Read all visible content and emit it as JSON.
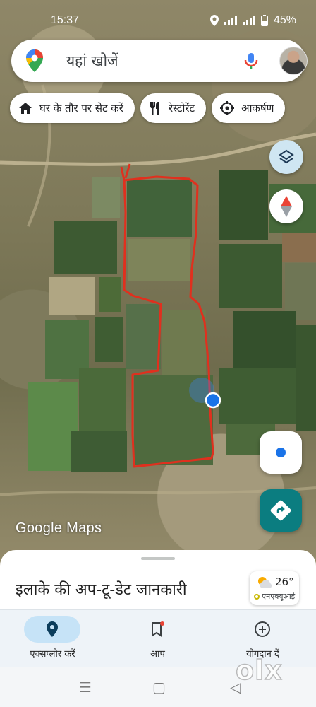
{
  "status_bar": {
    "time": "15:37",
    "battery": "45%"
  },
  "search": {
    "placeholder": "यहां खोजें"
  },
  "chips": [
    {
      "label": "घर के तौर पर सेट करें",
      "icon": "home-icon"
    },
    {
      "label": "रेस्टोरेंट",
      "icon": "restaurant-icon"
    },
    {
      "label": "आकर्षण",
      "icon": "attraction-icon"
    }
  ],
  "map": {
    "logo_text": "Google Maps"
  },
  "sheet": {
    "title": "इलाके की अप-टू-डेट जानकारी",
    "weather": {
      "temp": "26°",
      "aqi_label": "एनएक्यूआई"
    }
  },
  "nav": [
    {
      "label": "एक्सप्लोर करें",
      "icon": "explore-pin-icon",
      "active": true
    },
    {
      "label": "आप",
      "icon": "saved-bookmark-icon",
      "active": false
    },
    {
      "label": "योगदान दें",
      "icon": "contribute-plus-icon",
      "active": false
    }
  ],
  "watermark": "olx",
  "colors": {
    "accent": "#1a73e8",
    "boundary": "#e0301e",
    "directions": "#0b7d80"
  }
}
